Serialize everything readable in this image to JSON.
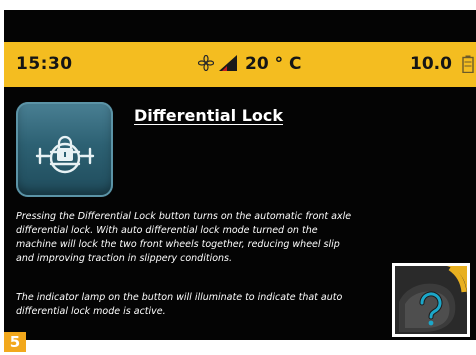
{
  "status_bar": {
    "time": "15:30",
    "temperature": "20 ° C",
    "speed": "10.0"
  },
  "icons": {
    "fan": "fan-icon",
    "signal": "signal-icon",
    "battery": "battery-icon",
    "differential_lock": "differential-lock-icon",
    "help": "question-mark-icon"
  },
  "main": {
    "title": "Differential Lock",
    "description": "Pressing the Differential Lock button turns on the automatic front axle differential lock. With auto differential lock mode turned on the machine will lock the two front wheels together, reducing wheel slip and improving traction in slippery conditions.",
    "indicator_note": "The indicator lamp on the button will illuminate to indicate that auto differential lock mode is active."
  },
  "step_number": "5",
  "colors": {
    "status_bar": "#f4bd20",
    "screen_background": "#040404",
    "button_teal": "#2d6173",
    "step_badge": "#f2a81c",
    "inset_accent": "#e8b020"
  }
}
